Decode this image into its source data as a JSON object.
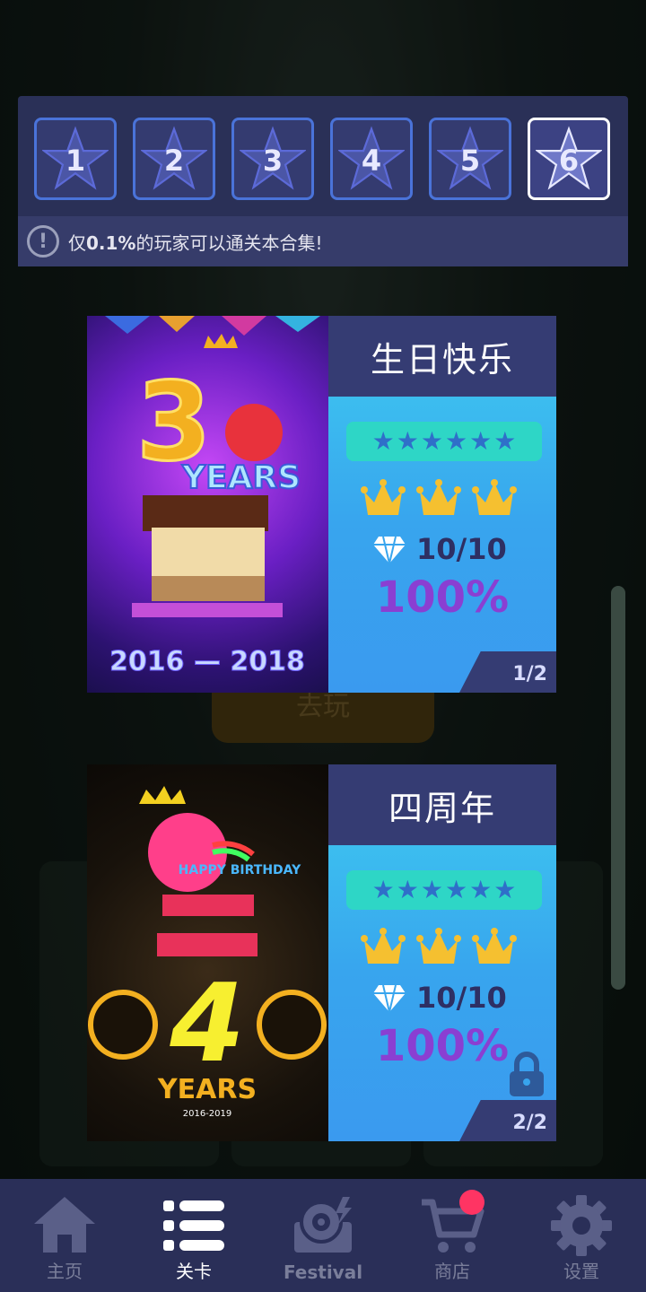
{
  "star_selector": {
    "buttons": [
      {
        "label": "1",
        "active": false
      },
      {
        "label": "2",
        "active": false
      },
      {
        "label": "3",
        "active": false
      },
      {
        "label": "4",
        "active": false
      },
      {
        "label": "5",
        "active": false
      },
      {
        "label": "6",
        "active": true
      }
    ],
    "info_icon": "!",
    "info_prefix": "仅",
    "info_highlight": "0.1%",
    "info_suffix": "的玩家可以通关本合集!"
  },
  "levels": [
    {
      "title": "生日快乐",
      "art_year": "3",
      "art_years_text": "YEARS",
      "art_range": "2016 — 2018",
      "stars": 6,
      "crowns": 3,
      "gems": "10/10",
      "percent": "100%",
      "page": "1/2",
      "locked": false
    },
    {
      "title": "四周年",
      "art_year": "4",
      "art_years_text": "YEARS",
      "art_banner": "HAPPY BIRTHDAY",
      "art_range": "2016-2019",
      "stars": 6,
      "crowns": 3,
      "gems": "10/10",
      "percent": "100%",
      "page": "2/2",
      "locked": true
    }
  ],
  "background": {
    "play_button": "去玩"
  },
  "nav": {
    "items": [
      {
        "label": "主页",
        "icon": "home-icon",
        "active": false
      },
      {
        "label": "关卡",
        "icon": "list-icon",
        "active": true
      },
      {
        "label": "Festival",
        "icon": "festival-icon",
        "active": false
      },
      {
        "label": "商店",
        "icon": "cart-icon",
        "active": false,
        "badge": true
      },
      {
        "label": "设置",
        "icon": "gear-icon",
        "active": false
      }
    ]
  },
  "colors": {
    "panel": "#2a3057",
    "accent_blue": "#4a73d9",
    "percent": "#8a3fd2",
    "crown": "#f5c030",
    "badge": "#ff3463"
  }
}
